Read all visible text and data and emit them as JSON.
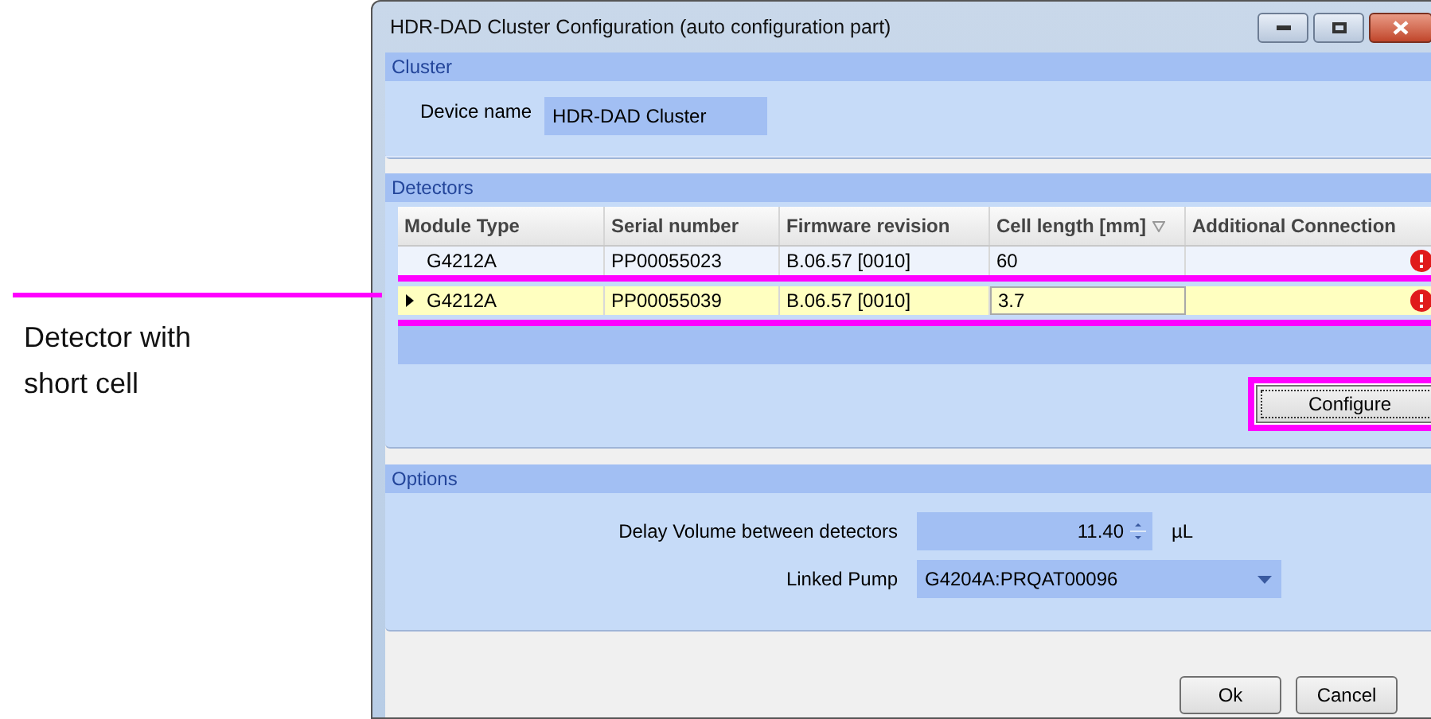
{
  "window": {
    "title": "HDR-DAD Cluster Configuration (auto configuration part)"
  },
  "cluster": {
    "header": "Cluster",
    "device_name": {
      "label": "Device name",
      "value": "HDR-DAD Cluster"
    }
  },
  "detectors": {
    "header": "Detectors",
    "columns": [
      {
        "label": "Module Type",
        "sorted": false
      },
      {
        "label": "Serial number",
        "sorted": false
      },
      {
        "label": "Firmware revision",
        "sorted": false
      },
      {
        "label": "Cell length [mm]",
        "sorted": true
      },
      {
        "label": "Additional Connection",
        "sorted": false
      }
    ],
    "rows": [
      {
        "cells": [
          "G4212A",
          "PP00055023",
          "B.06.57 [0010]",
          "60",
          ""
        ],
        "selected": false,
        "error": true
      },
      {
        "cells": [
          "G4212A",
          "PP00055039",
          "B.06.57 [0010]",
          "3.7",
          ""
        ],
        "selected": true,
        "error": true
      }
    ],
    "configure_button": "Configure"
  },
  "options": {
    "header": "Options",
    "delay_volume": {
      "label": "Delay Volume between detectors",
      "value": "11.40",
      "unit": "µL"
    },
    "linked_pump": {
      "label": "Linked Pump",
      "value": "G4204A:PRQAT00096"
    }
  },
  "buttons": [
    "Ok",
    "Cancel"
  ],
  "annotation": {
    "label": "Detector with short cell"
  }
}
